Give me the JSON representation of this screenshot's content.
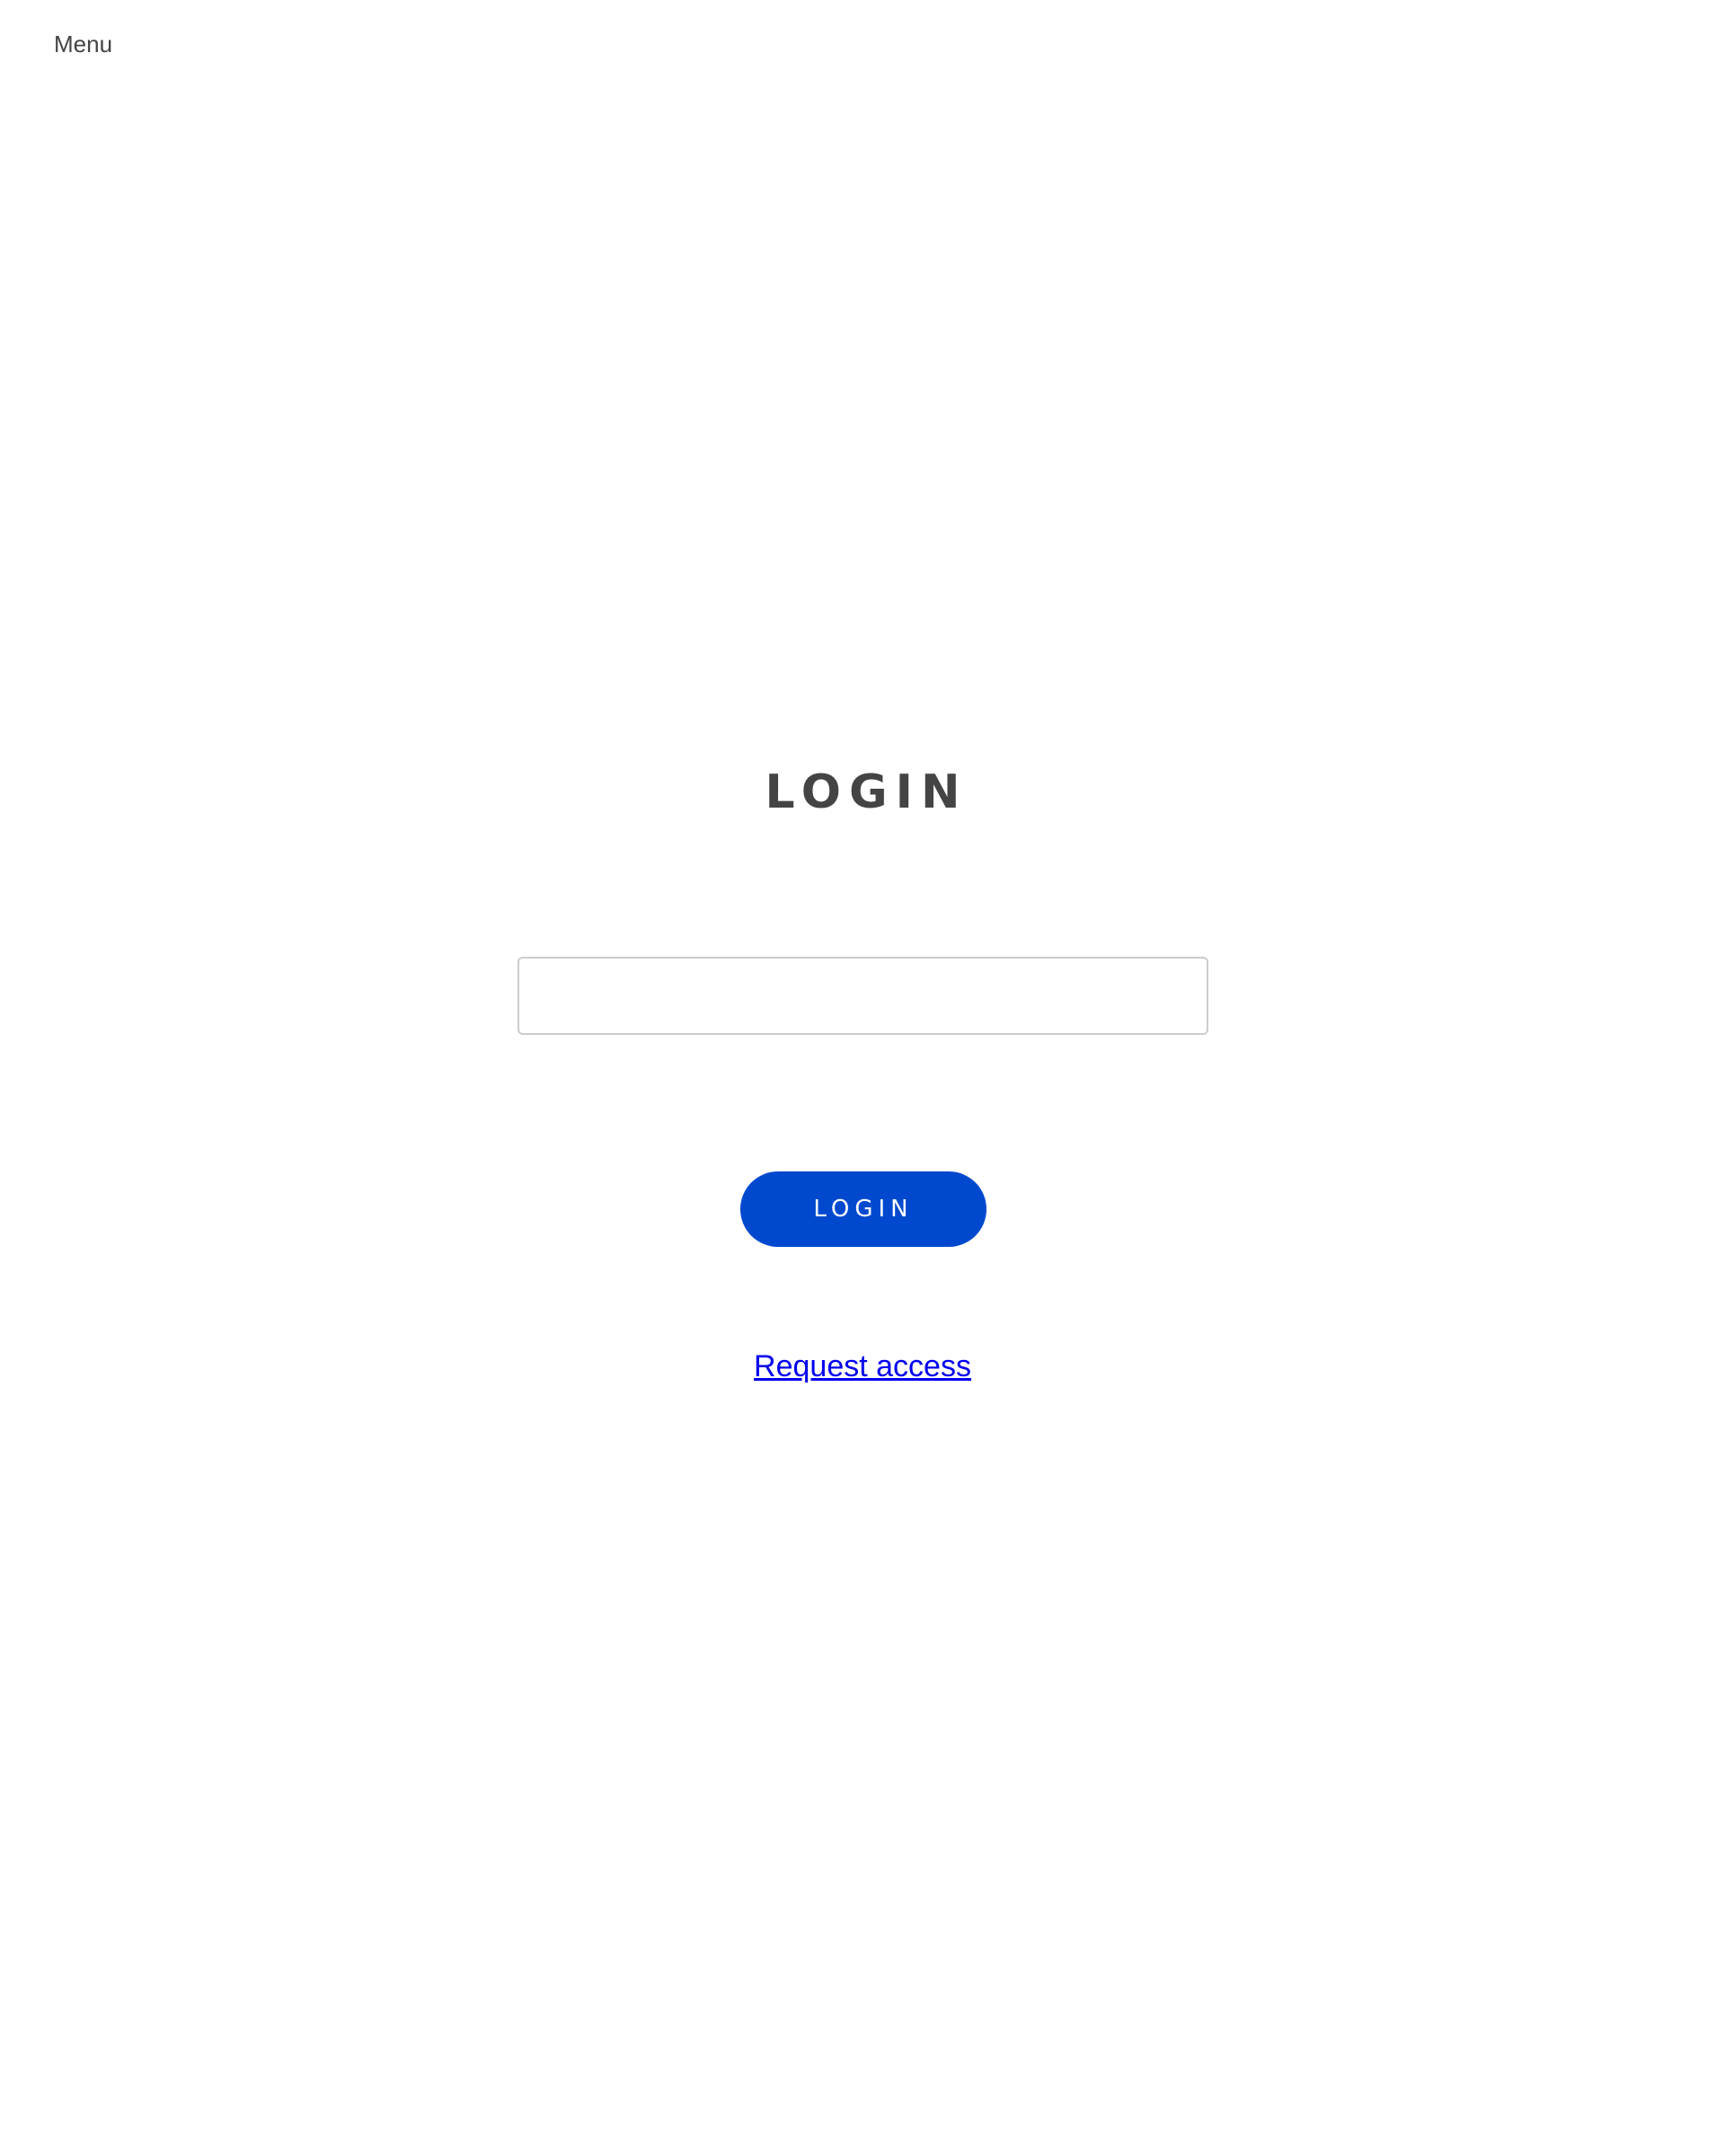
{
  "header": {
    "menu_label": "Menu"
  },
  "login": {
    "title": "LOGIN",
    "input_value": "",
    "button_label": "LOGIN",
    "request_access_label": "Request access"
  },
  "colors": {
    "accent": "#0049cf",
    "link": "#0000ee",
    "text": "#444444"
  }
}
